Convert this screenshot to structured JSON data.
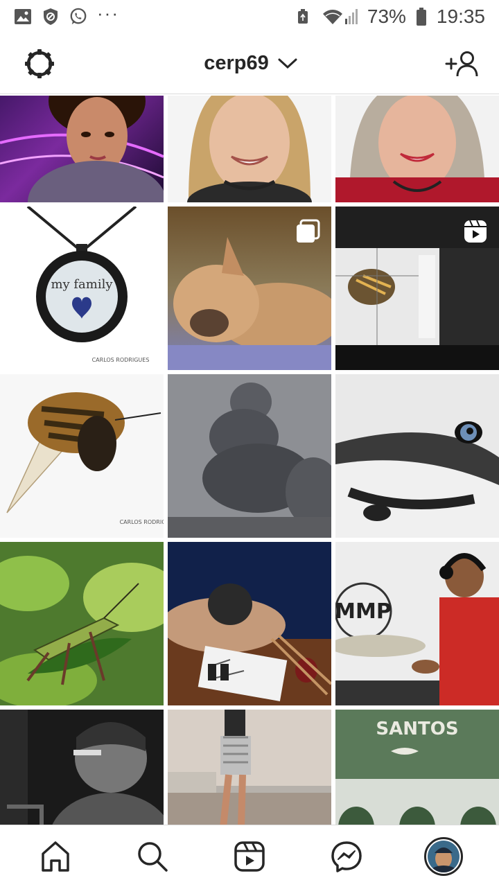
{
  "status_bar": {
    "battery_percent": "73%",
    "time": "19:35",
    "left_icons": [
      "image-icon",
      "shield-icon",
      "whatsapp-icon"
    ],
    "more_dots": "···"
  },
  "header": {
    "username": "cerp69",
    "settings_icon": "settings-icon",
    "account_switch_icon": "chevron-down-icon",
    "add_person_icon": "add-person-icon"
  },
  "grid": {
    "tiles": [
      {
        "subject": "woman with purple light"
      },
      {
        "subject": "smiling blonde woman"
      },
      {
        "subject": "woman in red top"
      },
      {
        "subject": "my family pendant necklace"
      },
      {
        "subject": "french bulldog puppy sleeping",
        "overlay": "carousel-icon"
      },
      {
        "subject": "bee on camera screen",
        "overlay": "reels-icon"
      },
      {
        "subject": "bee macro"
      },
      {
        "subject": "storm cloud"
      },
      {
        "subject": "husky eye"
      },
      {
        "subject": "grasshopper on leaf"
      },
      {
        "subject": "person resting head on desk"
      },
      {
        "subject": "drummer in red shirt"
      },
      {
        "subject": "man with glasses black and white"
      },
      {
        "subject": "woman walking on beach"
      },
      {
        "subject": "santos aquarium building"
      }
    ],
    "watermark_text": "CARLOS RODRIGUES",
    "sign_text": "SANTOS",
    "drum_logo_text": "MMP",
    "pendant_text": "my family"
  },
  "bottom_nav": {
    "items": [
      "home-icon",
      "search-icon",
      "reels-icon",
      "messenger-icon",
      "profile-avatar"
    ]
  },
  "colors": {
    "text": "#262626",
    "divider": "#dbdbdb",
    "status": "#444444"
  }
}
